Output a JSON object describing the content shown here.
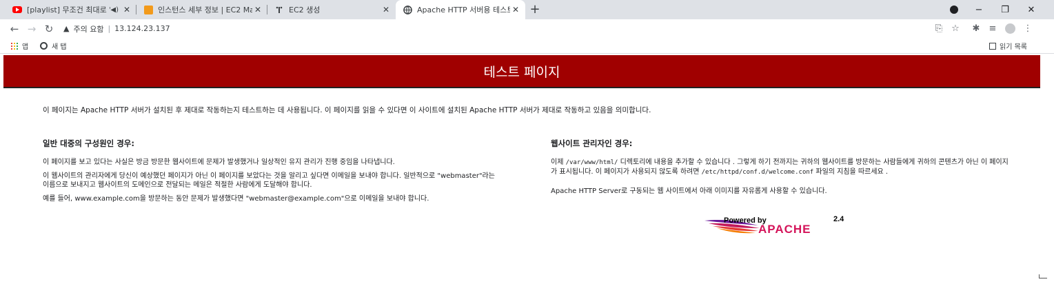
{
  "tabs": [
    {
      "title": "[playlist] 무조건 최대로 'V",
      "close": "✕",
      "favicon": "youtube-icon",
      "audio": "speaker-icon"
    },
    {
      "title": "인스턴스 세부 정보 | EC2 Ma",
      "close": "✕",
      "favicon": "aws-icon"
    },
    {
      "title": "EC2 생성",
      "close": "✕",
      "favicon": "page-icon"
    },
    {
      "title": "Apache HTTP 서버용 테스트 |",
      "close": "✕",
      "favicon": "globe-icon",
      "active": true
    }
  ],
  "tabstrip": {
    "new_tab": "+",
    "minimize": "−",
    "restore": "❐",
    "close": "✕"
  },
  "toolbar": {
    "back": "←",
    "forward": "→",
    "reload": "↻",
    "security_icon": "▲",
    "security_label": "주의 요함",
    "separator": "|",
    "url": "13.124.23.137",
    "translate": "⎘",
    "star": "☆",
    "extensions": "✱",
    "media": "≡",
    "menu": "⋮"
  },
  "bookmarks": {
    "apps_label": "앱",
    "newtab_label": "새 탭",
    "reading_list": "읽기 목록"
  },
  "page": {
    "banner_title": "테스트 페이지",
    "intro": "이 페이지는 Apache HTTP 서버가 설치된 후 제대로 작동하는지 테스트하는 데 사용됩니다. 이 페이지를 읽을 수 있다면 이 사이트에 설치된 Apache HTTP 서버가 제대로 작동하고 있음을 의미합니다.",
    "left": {
      "heading": "일반 대중의 구성원인 경우:",
      "p1": "이 페이지를 보고 있다는 사실은 방금 방문한 웹사이트에 문제가 발생했거나 일상적인 유지 관리가 진행 중임을 나타냅니다.",
      "p2": "이 웹사이트의 관리자에게 당신이 예상했던 페이지가 아닌 이 페이지를 보았다는 것을 알리고 싶다면 이메일을 보내야 합니다. 일반적으로 \"webmaster\"라는 이름으로 보내지고 웹사이트의 도메인으로 전달되는 메일은 적절한 사람에게 도달해야 합니다.",
      "p3": "예를 들어, www.example.com을 방문하는 동안 문제가 발생했다면 \"webmaster@example.com\"으로 이메일을 보내야 합니다."
    },
    "right": {
      "heading": "웹사이트 관리자인 경우:",
      "p1_before": "이제 ",
      "p1_code1": "/var/www/html/",
      "p1_mid": " 디렉토리에 내용을 추가할 수 있습니다 . 그렇게 하기 전까지는 귀하의 웹사이트를 방문하는 사람들에게 귀하의 콘텐츠가 아닌 이 페이지가 표시됩니다. 이 페이지가 사용되지 않도록 하려면 ",
      "p1_code2": "/etc/httpd/conf.d/welcome.conf",
      "p1_after": " 파일의 지침을 따르세요 .",
      "p2": "Apache HTTP Server로 구동되는 웹 사이트에서 아래 이미지를 자유롭게 사용할 수 있습니다."
    },
    "powered_by": {
      "prefix": "Powered by",
      "brand": "APACHE",
      "version": "2.4"
    }
  },
  "colors": {
    "banner": "#a00000",
    "tabstrip": "#dee1e6",
    "apache_purple": "#6a1b9a",
    "apache_red": "#d4145a"
  }
}
